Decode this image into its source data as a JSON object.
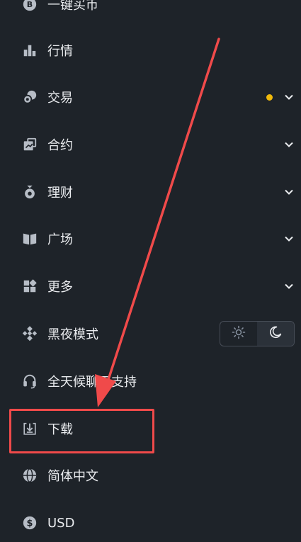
{
  "menu": {
    "buy_crypto": "一键买币",
    "markets": "行情",
    "trade": "交易",
    "futures": "合约",
    "earn": "理财",
    "square": "广场",
    "more": "更多",
    "dark_mode": "黑夜模式",
    "support": "全天候聊天支持",
    "download": "下载",
    "language": "简体中文",
    "currency": "USD"
  },
  "theme": {
    "selected": "dark"
  },
  "colors": {
    "background": "#1e2329",
    "text": "#eaecef",
    "icon": "#b7bdc6",
    "notification_dot": "#f0b90b",
    "annotation": "#f04a4a"
  },
  "icons": {
    "buy_crypto": "bitcoin-coin-icon",
    "markets": "bar-chart-icon",
    "trade": "coins-icon",
    "futures": "futures-icon",
    "earn": "money-bag-icon",
    "square": "book-icon",
    "more": "grid-icon",
    "dark_mode": "binance-logo-icon",
    "support": "headset-icon",
    "download": "download-icon",
    "language": "globe-icon",
    "currency": "dollar-coin-icon"
  }
}
